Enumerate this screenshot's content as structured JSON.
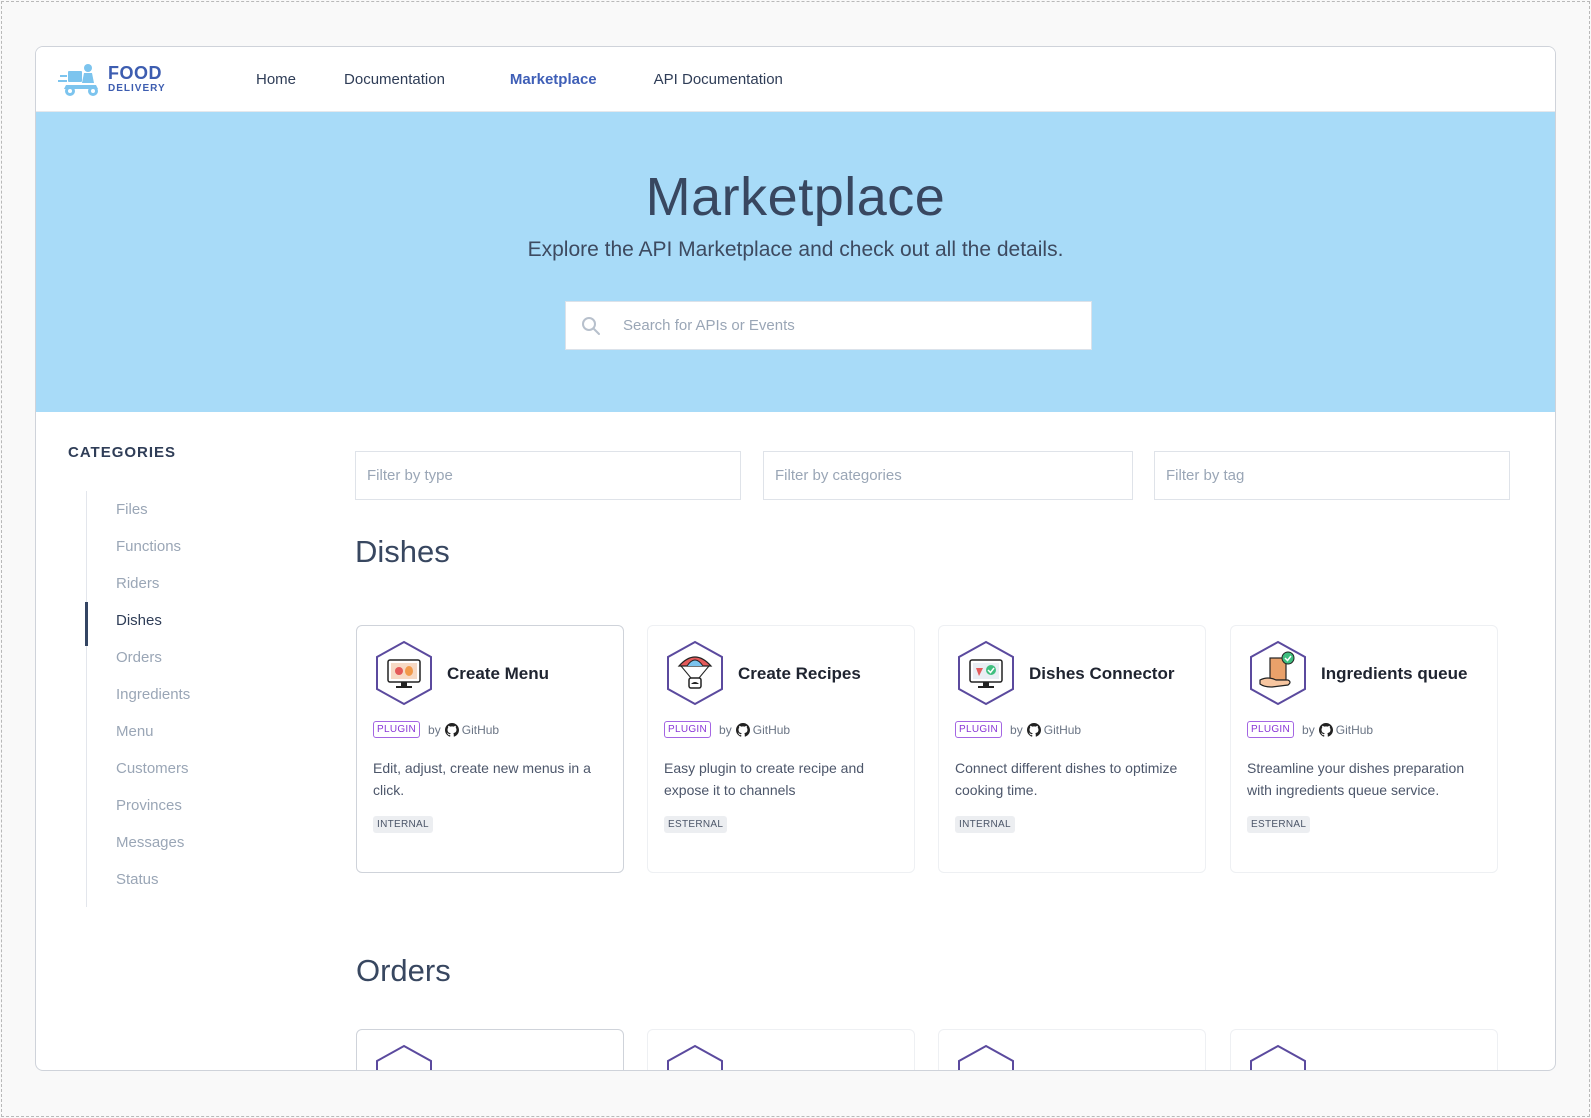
{
  "brand": {
    "line1": "FOOD",
    "line2": "DELIVERY"
  },
  "nav": {
    "items": [
      {
        "label": "Home",
        "active": false
      },
      {
        "label": "Documentation",
        "active": false
      },
      {
        "label": "Marketplace",
        "active": true
      },
      {
        "label": "API Documentation",
        "active": false
      }
    ]
  },
  "hero": {
    "title": "Marketplace",
    "subtitle": "Explore the API Marketplace and check out all the details.",
    "search_placeholder": "Search for APIs or Events",
    "background": "#a8dbf8"
  },
  "sidebar": {
    "title": "CATEGORIES",
    "items": [
      {
        "label": "Files"
      },
      {
        "label": "Functions"
      },
      {
        "label": "Riders"
      },
      {
        "label": "Dishes",
        "active": true
      },
      {
        "label": "Orders"
      },
      {
        "label": "Ingredients"
      },
      {
        "label": "Menu"
      },
      {
        "label": "Customers"
      },
      {
        "label": "Provinces"
      },
      {
        "label": "Messages"
      },
      {
        "label": "Status"
      }
    ]
  },
  "filters": {
    "type_placeholder": "Filter by type",
    "categories_placeholder": "Filter by categories",
    "tag_placeholder": "Filter by tag"
  },
  "sections": [
    {
      "title": "Dishes",
      "cards": [
        {
          "title": "Create Menu",
          "badge": "PLUGIN",
          "by": "by",
          "provider": "GitHub",
          "description": "Edit, adjust, create new menus in a click.",
          "tag": "INTERNAL",
          "icon": "monitor-food-icon"
        },
        {
          "title": "Create Recipes",
          "badge": "PLUGIN",
          "by": "by",
          "provider": "GitHub",
          "description": "Easy plugin to create recipe and expose it to channels",
          "tag": "ESTERNAL",
          "icon": "parachute-dish-icon"
        },
        {
          "title": "Dishes Connector",
          "badge": "PLUGIN",
          "by": "by",
          "provider": "GitHub",
          "description": "Connect different dishes to optimize cooking time.",
          "tag": "INTERNAL",
          "icon": "monitor-check-icon"
        },
        {
          "title": "Ingredients queue",
          "badge": "PLUGIN",
          "by": "by",
          "provider": "GitHub",
          "description": "Streamline your dishes preparation with ingredients queue service.",
          "tag": "ESTERNAL",
          "icon": "hand-box-check-icon"
        }
      ]
    },
    {
      "title": "Orders"
    }
  ],
  "colors": {
    "accent": "#3f5fb7",
    "badge": "#8a37d6"
  }
}
